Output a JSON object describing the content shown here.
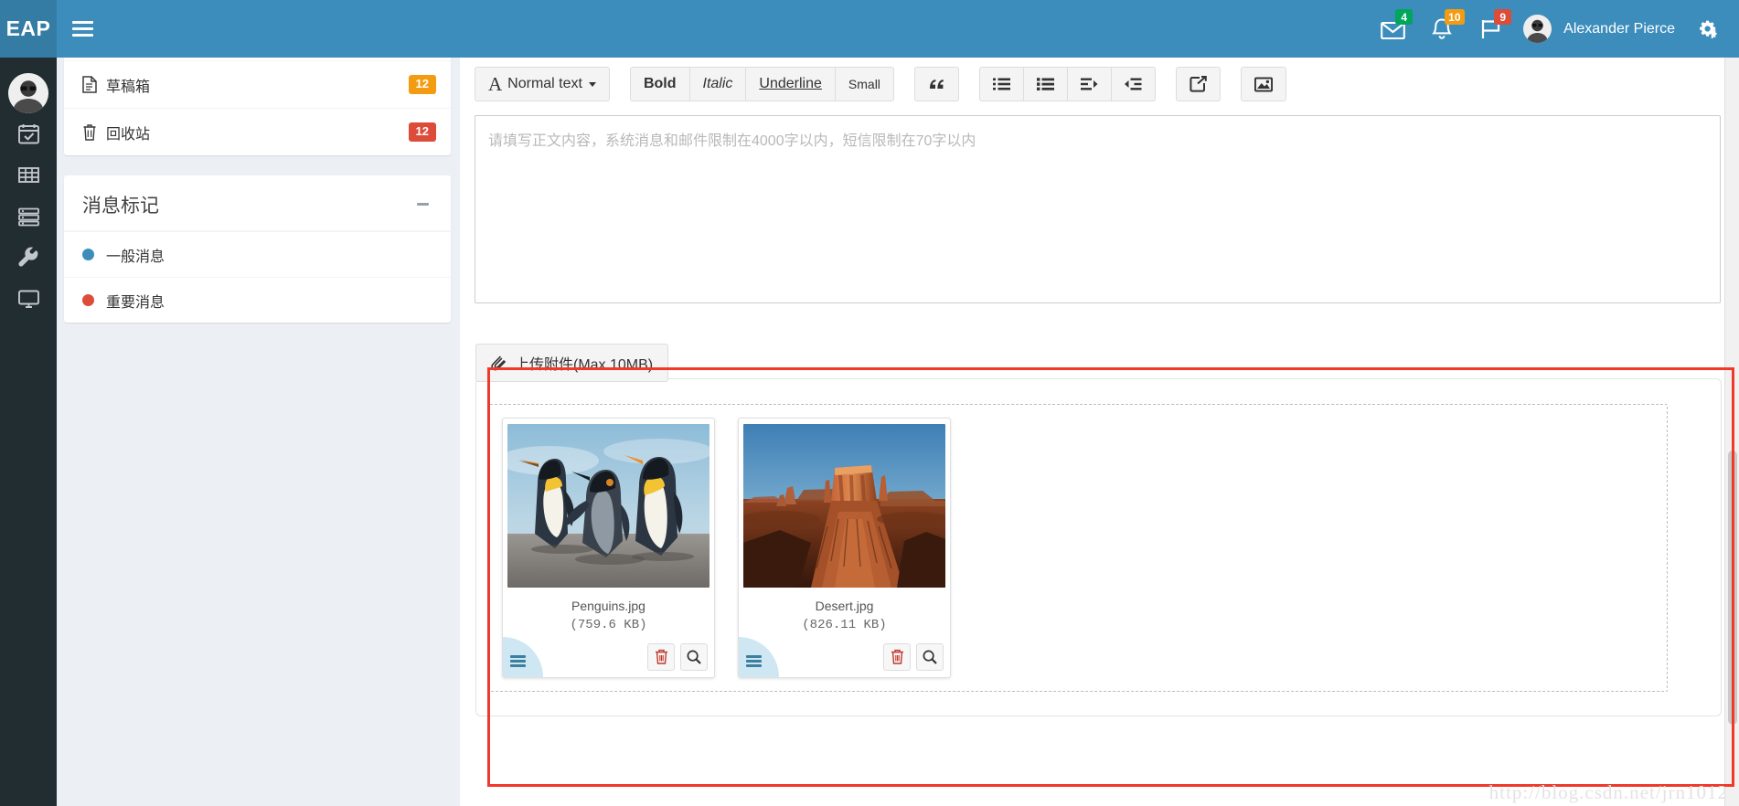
{
  "header": {
    "brand": "EAP",
    "menu_toggle_icon": "hamburger-icon",
    "messages": {
      "icon": "envelope-icon",
      "count": "4",
      "color": "#00a65a"
    },
    "notifications": {
      "icon": "bell-icon",
      "count": "10",
      "color": "#f39c12"
    },
    "tasks": {
      "icon": "flag-icon",
      "count": "9",
      "color": "#dd4b39"
    },
    "user_name": "Alexander Pierce",
    "settings_icon": "gear-icon"
  },
  "rail": {
    "avatar": "user-avatar",
    "items": [
      {
        "icon": "calendar-check-icon"
      },
      {
        "icon": "grid-table-icon"
      },
      {
        "icon": "server-list-icon"
      },
      {
        "icon": "wrench-icon"
      },
      {
        "icon": "monitor-icon"
      }
    ]
  },
  "folders": [
    {
      "icon": "file-text-icon",
      "label": "草稿箱",
      "count": "12",
      "badge_color": "#f39c12"
    },
    {
      "icon": "trash-icon",
      "label": "回收站",
      "count": "12",
      "badge_color": "#dd4b39"
    }
  ],
  "tags_panel": {
    "title": "消息标记",
    "collapse_icon": "minus-icon",
    "items": [
      {
        "label": "一般消息",
        "color": "#3c8dbc"
      },
      {
        "label": "重要消息",
        "color": "#dd4b39"
      }
    ]
  },
  "editor": {
    "style_select": "Normal text",
    "bold": "Bold",
    "italic": "Italic",
    "underline": "Underline",
    "small": "Small",
    "icon_buttons": [
      {
        "name": "blockquote-icon"
      },
      {
        "name": "unordered-list-icon"
      },
      {
        "name": "ordered-list-icon"
      },
      {
        "name": "indent-icon"
      },
      {
        "name": "outdent-icon"
      },
      {
        "name": "link-icon"
      },
      {
        "name": "image-icon"
      }
    ],
    "body_placeholder": "请填写正文内容，系统消息和邮件限制在4000字以内，短信限制在70字以内",
    "body_value": ""
  },
  "upload": {
    "button_label": "上传附件(Max 10MB)",
    "button_icon": "paperclip-icon",
    "files": [
      {
        "name": "Penguins.jpg",
        "size": "(759.6 KB)",
        "thumb": "penguins-photo",
        "delete_icon": "trash-icon",
        "preview_icon": "magnifier-icon",
        "drag_icon": "drag-handle-icon"
      },
      {
        "name": "Desert.jpg",
        "size": "(826.11 KB)",
        "thumb": "desert-photo",
        "delete_icon": "trash-icon",
        "preview_icon": "magnifier-icon",
        "drag_icon": "drag-handle-icon"
      }
    ]
  },
  "annotation": {
    "color": "#f0392b"
  },
  "watermark": "http://blog.csdn.net/jrn1012"
}
